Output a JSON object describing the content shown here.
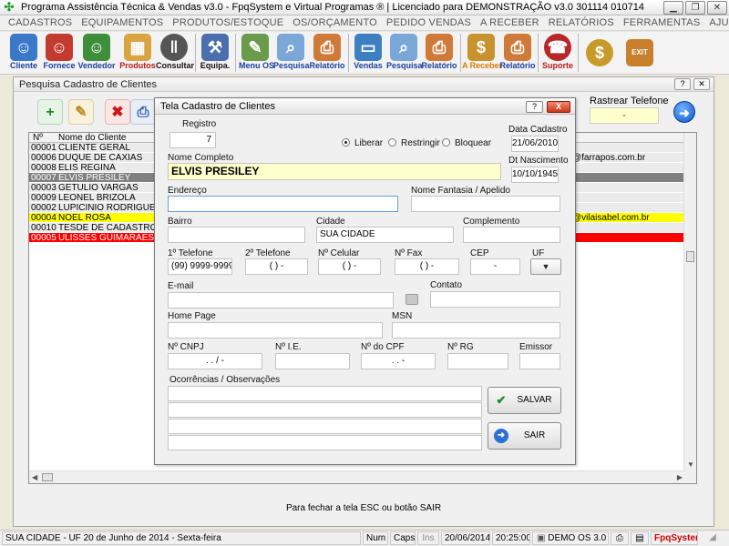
{
  "window": {
    "title": "Programa Assistência Técnica & Vendas v3.0 - FpqSystem e Virtual Programas ® | Licenciado para  DEMONSTRAÇÃO v3.0 301114 010714"
  },
  "menu": [
    "CADASTROS",
    "EQUIPAMENTOS",
    "PRODUTOS/ESTOQUE",
    "OS/ORÇAMENTO",
    "PEDIDO VENDAS",
    "A RECEBER",
    "RELATÓRIOS",
    "FERRAMENTAS",
    "AJUDA"
  ],
  "toolbar": {
    "cliente": "Cliente",
    "fornece": "Fornece",
    "vendedor": "Vendedor",
    "produtos": "Produtos",
    "consultar": "Consultar",
    "equipa": "Equipa.",
    "menu_os": "Menu OS",
    "pesquisa1": "Pesquisa",
    "relatorio1": "Relatório",
    "vendas": "Vendas",
    "pesquisa2": "Pesquisa",
    "relatorio2": "Relatório",
    "a_receber": "A Receber",
    "relatorio3": "Relatório",
    "suporte": "Suporte",
    "exit_tag": "EXIT"
  },
  "search_window": {
    "title": "Pesquisa Cadastro de Clientes",
    "rastrear_label": "Rastrear Telefone",
    "rastrear_value": "-",
    "col_num": "Nº",
    "col_name": "Nome do Cliente",
    "hint": "Para fechar a tela ESC ou botão SAIR",
    "rows": [
      {
        "num": "00001",
        "name": "CLIENTE GERAL",
        "extra": ""
      },
      {
        "num": "00006",
        "name": "DUQUE DE CAXIAS",
        "extra": "@farrapos.com.br"
      },
      {
        "num": "00008",
        "name": "ELIS REGINA",
        "extra": ""
      },
      {
        "num": "00007",
        "name": "ELVIS PRESILEY",
        "extra": ""
      },
      {
        "num": "00003",
        "name": "GETULIO VARGAS",
        "extra": ""
      },
      {
        "num": "00009",
        "name": "LEONEL BRIZOLA",
        "extra": ""
      },
      {
        "num": "00002",
        "name": "LUPICINIO RODRIGUES",
        "extra": ""
      },
      {
        "num": "00004",
        "name": "NOEL ROSA",
        "extra": "@vilaisabel.com.br"
      },
      {
        "num": "00010",
        "name": "TESDE DE CADASTRO",
        "extra": ""
      },
      {
        "num": "00005",
        "name": "ULISSES GUIMARAES",
        "extra": ""
      }
    ]
  },
  "dialog": {
    "title": "Tela Cadastro de Clientes",
    "help": "?",
    "close": "X",
    "registro_label": "Registro",
    "registro_value": "7",
    "status_options": {
      "liberar": "Liberar",
      "restringir": "Restringir",
      "bloquear": "Bloquear"
    },
    "data_cadastro_label": "Data Cadastro",
    "data_cadastro_value": "21/06/2010",
    "nome_label": "Nome Completo",
    "nome_value": "ELVIS PRESILEY",
    "nascimento_label": "Dt Nascimento",
    "nascimento_value": "10/10/1945",
    "endereco_label": "Endereço",
    "fantasia_label": "Nome Fantasia / Apelido",
    "bairro_label": "Bairro",
    "cidade_label": "Cidade",
    "cidade_value": "SUA CIDADE",
    "complemento_label": "Complemento",
    "tel1_label": "1º Telefone",
    "tel1_value": "(99) 9999-9999",
    "tel2_label": "2º Telefone",
    "tel2_value": "(  )    -",
    "cel_label": "Nº Celular",
    "cel_value": "(  )    -",
    "fax_label": "Nº Fax",
    "fax_value": "(  )    -",
    "cep_label": "CEP",
    "cep_value": "-",
    "uf_label": "UF",
    "email_label": "E-mail",
    "contato_label": "Contato",
    "homepage_label": "Home Page",
    "msn_label": "MSN",
    "cnpj_label": "Nº CNPJ",
    "cnpj_value": ".    .    /    -",
    "ie_label": "Nº I.E.",
    "cpf_label": "Nº do CPF",
    "cpf_value": ".    .    -",
    "rg_label": "Nº RG",
    "emissor_label": "Emissor",
    "obs_label": "Ocorrências / Observações",
    "salvar": "SALVAR",
    "sair": "SAIR"
  },
  "statusbar": {
    "city": "SUA CIDADE - UF 20 de Junho de 2014 - Sexta-feira",
    "num": "Num",
    "caps": "Caps",
    "ins": "Ins",
    "date": "20/06/2014",
    "time": "20:25:00",
    "version": "DEMO OS 3.0",
    "brand": "FpqSystem"
  },
  "colors": {
    "accent_blue": "#1a3fa0",
    "highlight_yellow": "#ffff00",
    "highlight_red": "#ff0000",
    "selected_row": "#808080"
  }
}
